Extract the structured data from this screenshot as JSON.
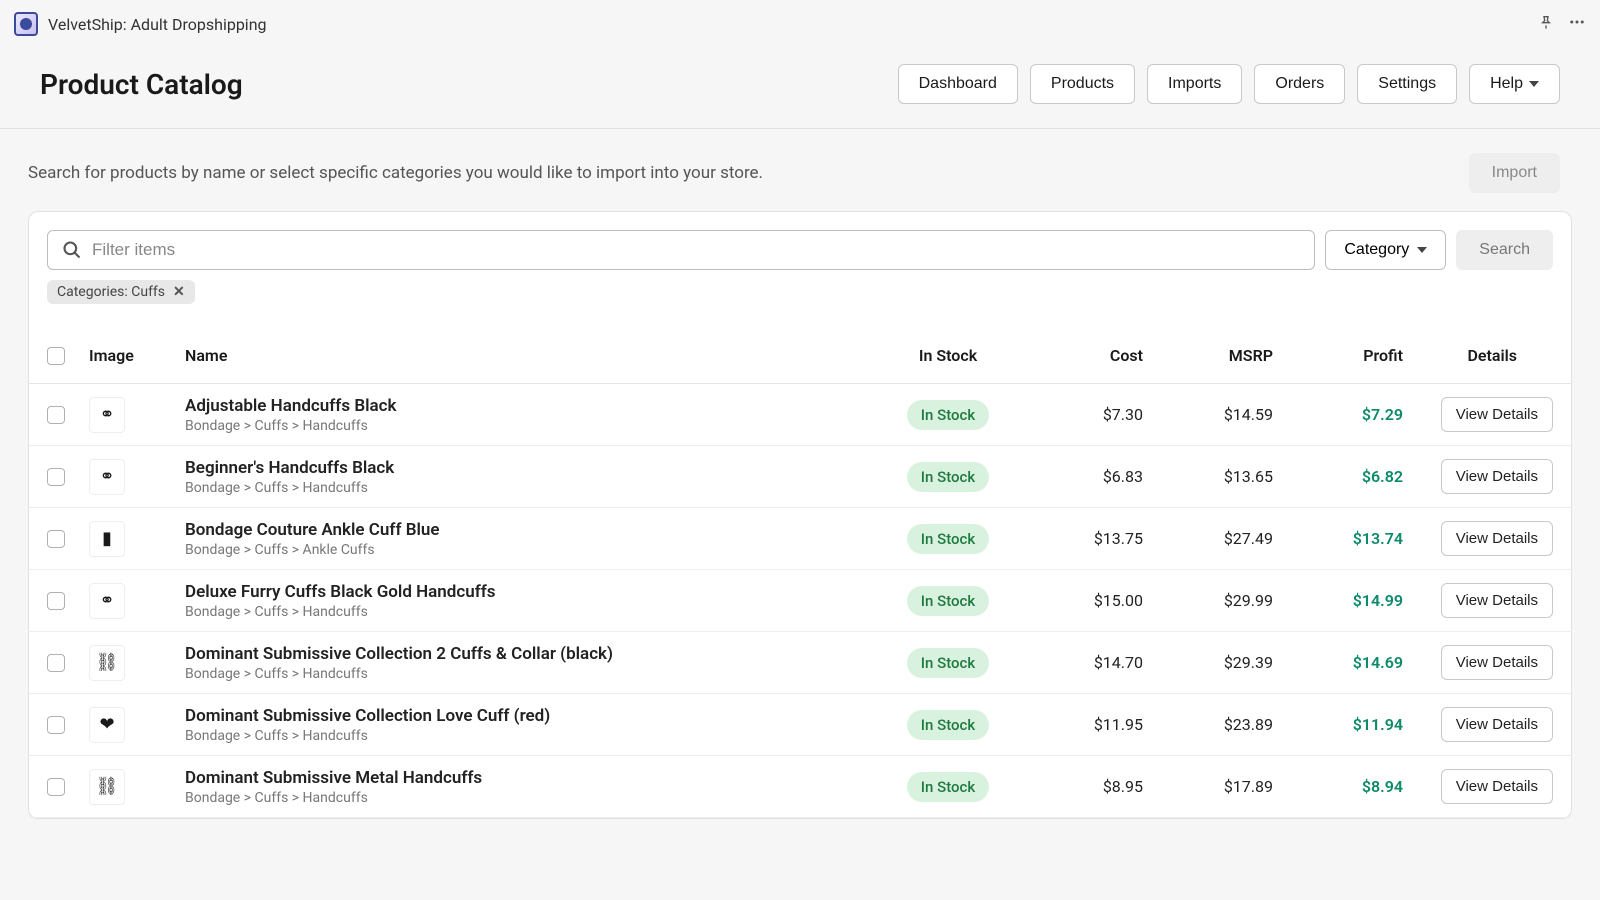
{
  "titlebar": {
    "app_name": "VelvetShip: Adult Dropshipping"
  },
  "header": {
    "title": "Product Catalog",
    "nav": {
      "dashboard": "Dashboard",
      "products": "Products",
      "imports": "Imports",
      "orders": "Orders",
      "settings": "Settings",
      "help": "Help"
    }
  },
  "subheader": {
    "text": "Search for products by name or select specific categories you would like to import into your store.",
    "import_label": "Import"
  },
  "search": {
    "placeholder": "Filter items",
    "category_label": "Category",
    "search_label": "Search"
  },
  "filter": {
    "chip_label": "Categories: Cuffs"
  },
  "columns": {
    "image": "Image",
    "name": "Name",
    "stock": "In Stock",
    "cost": "Cost",
    "msrp": "MSRP",
    "profit": "Profit",
    "details": "Details"
  },
  "stock_label": "In Stock",
  "view_label": "View Details",
  "products": [
    {
      "name": "Adjustable Handcuffs Black",
      "cat": "Bondage > Cuffs > Handcuffs",
      "cost": "$7.30",
      "msrp": "$14.59",
      "profit": "$7.29",
      "icon": "⚭"
    },
    {
      "name": "Beginner's Handcuffs Black",
      "cat": "Bondage > Cuffs > Handcuffs",
      "cost": "$6.83",
      "msrp": "$13.65",
      "profit": "$6.82",
      "icon": "⚭"
    },
    {
      "name": "Bondage Couture Ankle Cuff Blue",
      "cat": "Bondage > Cuffs > Ankle Cuffs",
      "cost": "$13.75",
      "msrp": "$27.49",
      "profit": "$13.74",
      "icon": "▮"
    },
    {
      "name": "Deluxe Furry Cuffs Black Gold Handcuffs",
      "cat": "Bondage > Cuffs > Handcuffs",
      "cost": "$15.00",
      "msrp": "$29.99",
      "profit": "$14.99",
      "icon": "⚭"
    },
    {
      "name": "Dominant Submissive Collection 2 Cuffs & Collar (black)",
      "cat": "Bondage > Cuffs > Handcuffs",
      "cost": "$14.70",
      "msrp": "$29.39",
      "profit": "$14.69",
      "icon": "⛓"
    },
    {
      "name": "Dominant Submissive Collection Love Cuff (red)",
      "cat": "Bondage > Cuffs > Handcuffs",
      "cost": "$11.95",
      "msrp": "$23.89",
      "profit": "$11.94",
      "icon": "❤"
    },
    {
      "name": "Dominant Submissive Metal Handcuffs",
      "cat": "Bondage > Cuffs > Handcuffs",
      "cost": "$8.95",
      "msrp": "$17.89",
      "profit": "$8.94",
      "icon": "⛓"
    }
  ]
}
